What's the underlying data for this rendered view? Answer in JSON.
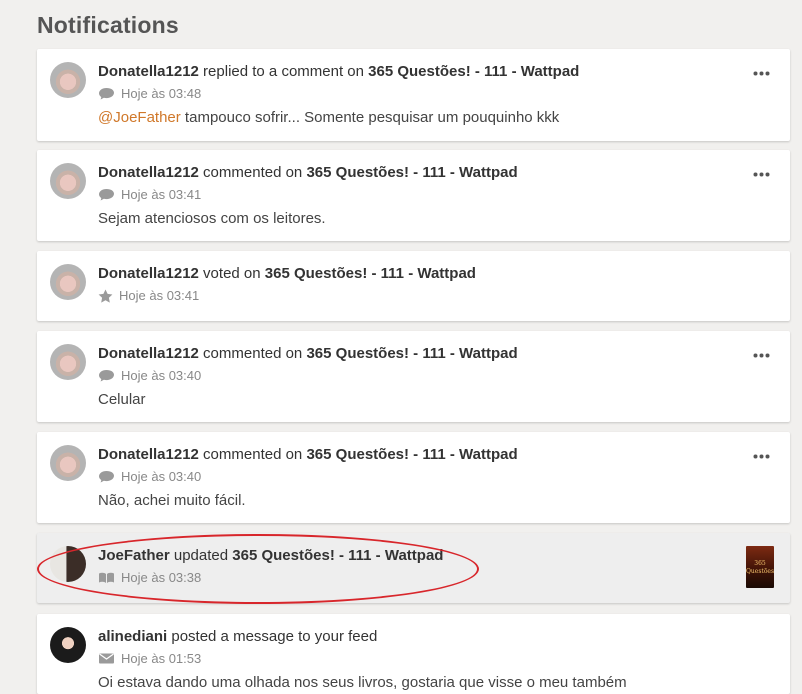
{
  "page": {
    "title": "Notifications"
  },
  "notifications": [
    {
      "user": "Donatella1212",
      "action": " replied to a comment on ",
      "story": "365 Questões! - 111 - Wattpad",
      "time": "Hoje às 03:48",
      "mention": "@JoeFather",
      "message": " tampouco sofrir... Somente pesquisar um pouquinho kkk",
      "icon": "comment-icon"
    },
    {
      "user": "Donatella1212",
      "action": " commented on ",
      "story": "365 Questões! - 111 - Wattpad",
      "time": "Hoje às 03:41",
      "message": "Sejam atenciosos com os leitores.",
      "icon": "comment-icon"
    },
    {
      "user": "Donatella1212",
      "action": " voted on ",
      "story": "365 Questões! - 111 - Wattpad",
      "time": "Hoje às 03:41",
      "icon": "star-icon"
    },
    {
      "user": "Donatella1212",
      "action": " commented on ",
      "story": "365 Questões! - 111 - Wattpad",
      "time": "Hoje às 03:40",
      "message": "Celular",
      "icon": "comment-icon"
    },
    {
      "user": "Donatella1212",
      "action": " commented on ",
      "story": "365 Questões! - 111 - Wattpad",
      "time": "Hoje às 03:40",
      "message": "Não, achei muito fácil.",
      "icon": "comment-icon"
    },
    {
      "user": "JoeFather",
      "action": " updated ",
      "story": "365 Questões!",
      "story_suffix": " - 111 - Wattpad",
      "time": "Hoje às 03:38",
      "icon": "book-icon",
      "thumbnail_text": "365 Questões"
    },
    {
      "user": "alinediani",
      "action": " posted a message to your feed",
      "time": "Hoje às 01:53",
      "message": "Oi estava dando uma olhada nos seus livros, gostaria que visse o meu também",
      "icon": "envelope-icon"
    }
  ],
  "colors": {
    "background": "#f1f0ee",
    "mention": "#d0782a",
    "highlight_row": "#eeeeee",
    "annotation_circle": "#d8262b"
  }
}
